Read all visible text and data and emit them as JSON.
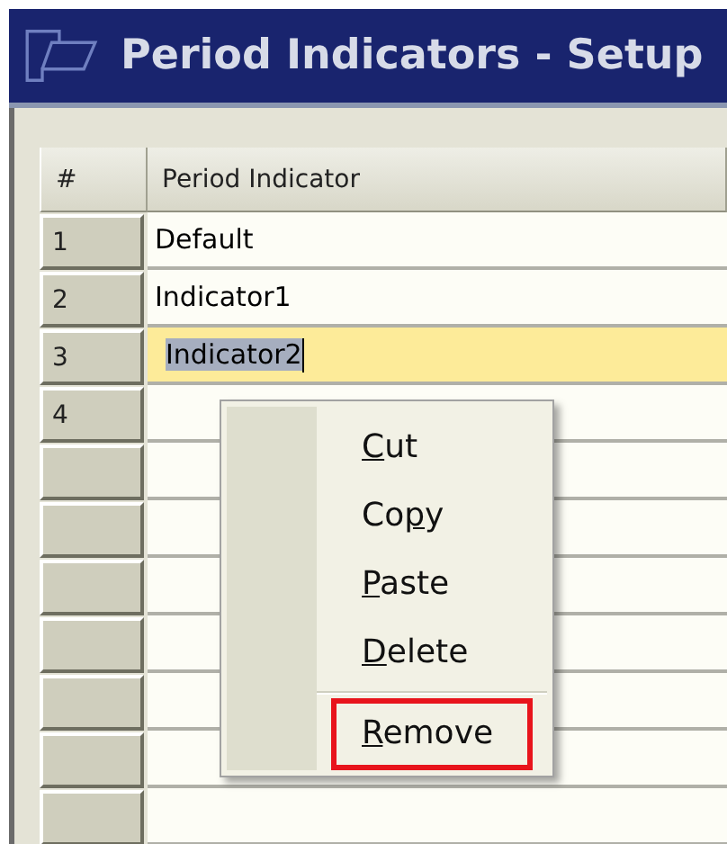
{
  "window": {
    "title": "Period Indicators - Setup"
  },
  "table": {
    "columns": [
      "#",
      "Period Indicator"
    ],
    "rows": [
      {
        "number": "1",
        "indicator": "Default",
        "selected": false
      },
      {
        "number": "2",
        "indicator": "Indicator1",
        "selected": false
      },
      {
        "number": "3",
        "indicator": "Indicator2",
        "selected": true
      },
      {
        "number": "4",
        "selected": false
      },
      {
        "selected": false
      },
      {
        "selected": false
      },
      {
        "selected": false
      },
      {
        "selected": false
      },
      {
        "selected": false
      },
      {
        "selected": false
      },
      {
        "selected": false
      }
    ]
  },
  "context_menu": {
    "items": [
      {
        "label": {
          "access_key": "C",
          "rest": "ut"
        },
        "highlighted": false
      },
      {
        "label": {
          "lead": "Co",
          "access_key": "p",
          "rest": "y"
        },
        "highlighted": false
      },
      {
        "label": {
          "access_key": "P",
          "rest": "aste"
        },
        "highlighted": false
      },
      {
        "label": {
          "access_key": "D",
          "rest": "elete"
        },
        "highlighted": false,
        "separator_after": true
      },
      {
        "label": {
          "access_key": "R",
          "rest": "emove"
        },
        "highlighted": true
      }
    ]
  }
}
